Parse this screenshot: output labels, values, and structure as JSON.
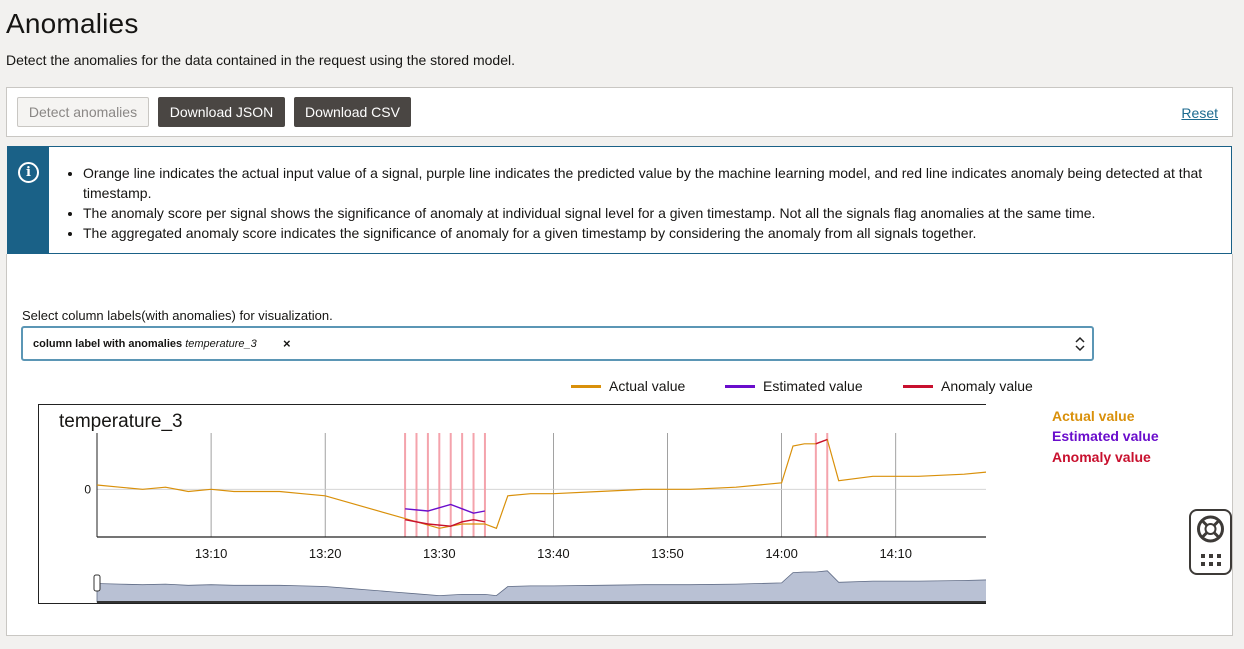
{
  "page": {
    "title": "Anomalies",
    "description": "Detect the anomalies for the data contained in the request using the stored model."
  },
  "toolbar": {
    "detect_label": "Detect anomalies",
    "download_json_label": "Download JSON",
    "download_csv_label": "Download CSV",
    "reset_label": "Reset"
  },
  "info": {
    "icon": "info-icon",
    "items": [
      "Orange line indicates the actual input value of a signal, purple line indicates the predicted value by the machine learning model, and red line indicates anomaly being detected at that timestamp.",
      "The anomaly score per signal shows the significance of anomaly at individual signal level for a given timestamp. Not all the signals flag anomalies at the same time.",
      "The aggregated anomaly score indicates the significance of anomaly for a given timestamp by considering the anomaly from all signals together."
    ]
  },
  "selector": {
    "label": "Select column labels(with anomalies) for visualization.",
    "chip_prefix": "column label with anomalies",
    "chip_value": "temperature_3",
    "chip_remove": "×"
  },
  "legend": {
    "actual": "Actual value",
    "estimated": "Estimated value",
    "anomaly": "Anomaly value"
  },
  "colors": {
    "actual": "#d9900a",
    "estimated": "#6a0dcc",
    "anomaly": "#c8102e",
    "anomaly_band": "#f4a3ac",
    "info": "#1a6187"
  },
  "chart_data": {
    "type": "line",
    "title": "temperature_3",
    "x_ticks": [
      "13:10",
      "13:20",
      "13:30",
      "13:40",
      "13:50",
      "14:00",
      "14:10"
    ],
    "y_ticks": [
      "0"
    ],
    "xlim": [
      "13:00",
      "14:18"
    ],
    "anomaly_times": [
      "13:27",
      "13:28",
      "13:29",
      "13:30",
      "13:31",
      "13:32",
      "13:33",
      "13:34",
      "14:03",
      "14:04"
    ],
    "series": [
      {
        "name": "Actual value",
        "x": [
          "13:00",
          "13:02",
          "13:04",
          "13:06",
          "13:08",
          "13:10",
          "13:12",
          "13:14",
          "13:16",
          "13:18",
          "13:20",
          "13:22",
          "13:24",
          "13:26",
          "13:28",
          "13:30",
          "13:32",
          "13:34",
          "13:35",
          "13:36",
          "13:38",
          "13:40",
          "13:44",
          "13:48",
          "13:52",
          "13:56",
          "14:00",
          "14:01",
          "14:02",
          "14:03",
          "14:04",
          "14:05",
          "14:08",
          "14:12",
          "14:16",
          "14:18"
        ],
        "values": [
          0.2,
          0.1,
          0.0,
          0.1,
          -0.1,
          0.0,
          -0.1,
          -0.1,
          -0.1,
          -0.2,
          -0.3,
          -0.6,
          -0.9,
          -1.2,
          -1.5,
          -1.8,
          -1.6,
          -1.6,
          -1.8,
          -0.3,
          -0.2,
          -0.2,
          -0.1,
          0.0,
          0.0,
          0.1,
          0.3,
          2.0,
          2.1,
          2.1,
          2.3,
          0.4,
          0.6,
          0.6,
          0.7,
          0.8
        ]
      },
      {
        "name": "Estimated value",
        "x": [
          "13:27",
          "13:29",
          "13:31",
          "13:32",
          "13:33",
          "13:34"
        ],
        "values": [
          -0.9,
          -1.0,
          -0.7,
          -0.9,
          -1.1,
          -1.0
        ]
      },
      {
        "name": "Anomaly value",
        "x": [
          "13:27",
          "13:29",
          "13:31",
          "13:32",
          "13:33",
          "13:34",
          "14:03",
          "14:04"
        ],
        "values": [
          -1.4,
          -1.6,
          -1.7,
          -1.5,
          -1.4,
          -1.5,
          2.1,
          2.3
        ]
      }
    ]
  }
}
